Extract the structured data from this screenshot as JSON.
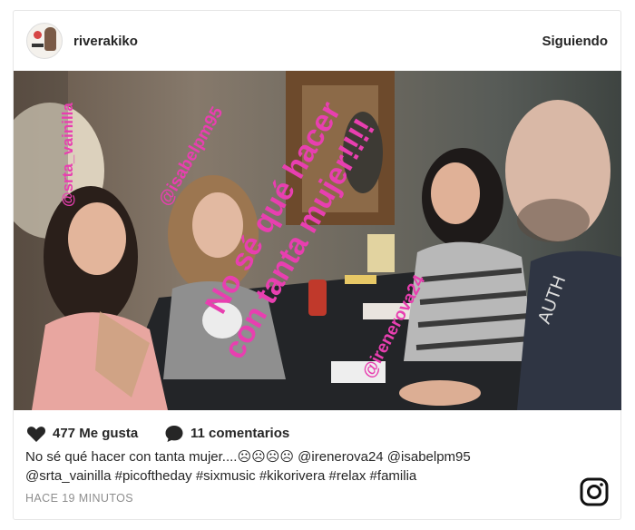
{
  "post": {
    "username": "riverakiko",
    "follow_label": "Siguiendo",
    "photo_overlay": {
      "main_text_line1": "No sé qué hacer",
      "main_text_line2": "con tanta mujer!!!!",
      "tag_1": "@srta_vainilla",
      "tag_2": "@isabelpm95",
      "tag_3": "@irenerova24",
      "overlay_color": "#e83fb0"
    },
    "likes_label": "477 Me gusta",
    "comments_label": "11 comentarios",
    "caption_line1": "No sé qué hacer con tanta mujer....☹☹☹☹ @irenerova24 @isabelpm95",
    "caption_line2": "@srta_vainilla #picoftheday #sixmusic #kikorivera #relax #familia",
    "time_label": "HACE 19 MINUTOS",
    "icons": {
      "like": "heart-icon",
      "comment": "comment-bubble-icon",
      "brand": "instagram-icon"
    }
  }
}
